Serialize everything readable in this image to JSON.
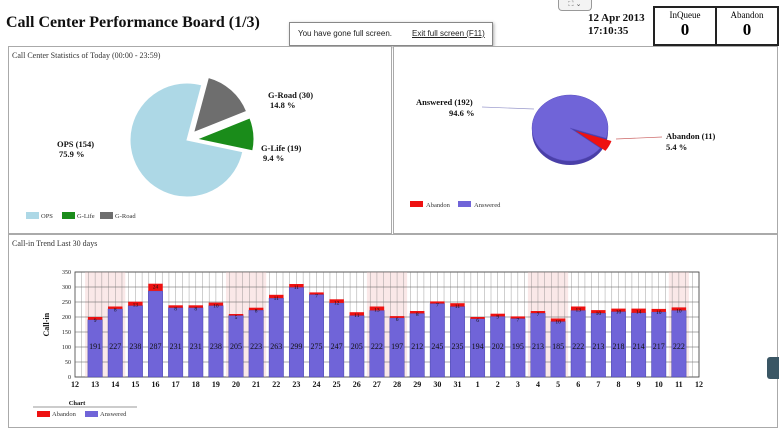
{
  "header": {
    "title": "Call Center Performance Board (1/3)",
    "date": "12 Apr 2013",
    "time": "17:10:35"
  },
  "counters": [
    {
      "label": "InQueue",
      "value": "0"
    },
    {
      "label": "Abandon",
      "value": "0"
    }
  ],
  "notification": {
    "message": "You have gone full screen.",
    "exit_label": "Exit full screen (F11)"
  },
  "panels": {
    "stats_title": "Call Center Statistics of Today (00:00 - 23:59)",
    "trend_title": "Call-in Trend Last 30 days"
  },
  "colors": {
    "ops": "#add8e6",
    "g_life": "#1a8c1a",
    "g_road": "#6e6e6e",
    "answered": "#7064d8",
    "abandon": "#ee1111"
  },
  "chart_data": [
    {
      "type": "pie",
      "labels": [
        "OPS",
        "G-Life",
        "G-Road"
      ],
      "values": [
        154,
        19,
        30
      ],
      "percentages": [
        "75.9 %",
        "9.4 %",
        "14.8 %"
      ],
      "slice_labels": [
        "OPS (154)",
        "G-Life (19)",
        "G-Road (30)"
      ],
      "legend": [
        "OPS",
        "G-Life",
        "G-Road"
      ],
      "legend_position": "bottom-left",
      "exploded": true
    },
    {
      "type": "pie",
      "labels": [
        "Answered",
        "Abandon"
      ],
      "values": [
        192,
        11
      ],
      "percentages": [
        "94.6 %",
        "5.4 %"
      ],
      "slice_labels": [
        "Answered (192)",
        "Abandon (11)"
      ],
      "legend": [
        "Abandon",
        "Answered"
      ],
      "legend_position": "bottom-left",
      "style": "3d"
    },
    {
      "type": "bar",
      "stacked": true,
      "ylabel": "Call-in",
      "ylim": [
        0,
        350
      ],
      "yticks": [
        "0",
        "50",
        "100",
        "150",
        "200",
        "250",
        "300",
        "350"
      ],
      "x_edge_labels": [
        "12",
        "12"
      ],
      "categories": [
        "13",
        "14",
        "15",
        "16",
        "17",
        "18",
        "19",
        "20",
        "21",
        "22",
        "23",
        "24",
        "25",
        "26",
        "27",
        "28",
        "29",
        "30",
        "31",
        "1",
        "2",
        "3",
        "4",
        "5",
        "6",
        "7",
        "8",
        "9",
        "10",
        "11"
      ],
      "series": [
        {
          "name": "Answered",
          "values": [
            191,
            227,
            238,
            287,
            231,
            231,
            238,
            205,
            223,
            263,
            299,
            275,
            247,
            205,
            222,
            197,
            212,
            245,
            235,
            194,
            202,
            195,
            213,
            185,
            222,
            213,
            218,
            214,
            217,
            222
          ]
        },
        {
          "name": "Abandon",
          "values": [
            9,
            8,
            13,
            24,
            8,
            8,
            10,
            5,
            8,
            11,
            11,
            7,
            12,
            11,
            13,
            6,
            8,
            7,
            11,
            6,
            9,
            7,
            7,
            10,
            13,
            10,
            10,
            14,
            10,
            10
          ]
        }
      ],
      "highlight_weekends": [
        "13",
        "14",
        "20",
        "21",
        "27",
        "28",
        "4",
        "5",
        "11"
      ],
      "legend_title": "Chart",
      "legend": [
        "Abandon",
        "Answered"
      ],
      "legend_position": "bottom-left",
      "grid": true
    }
  ]
}
